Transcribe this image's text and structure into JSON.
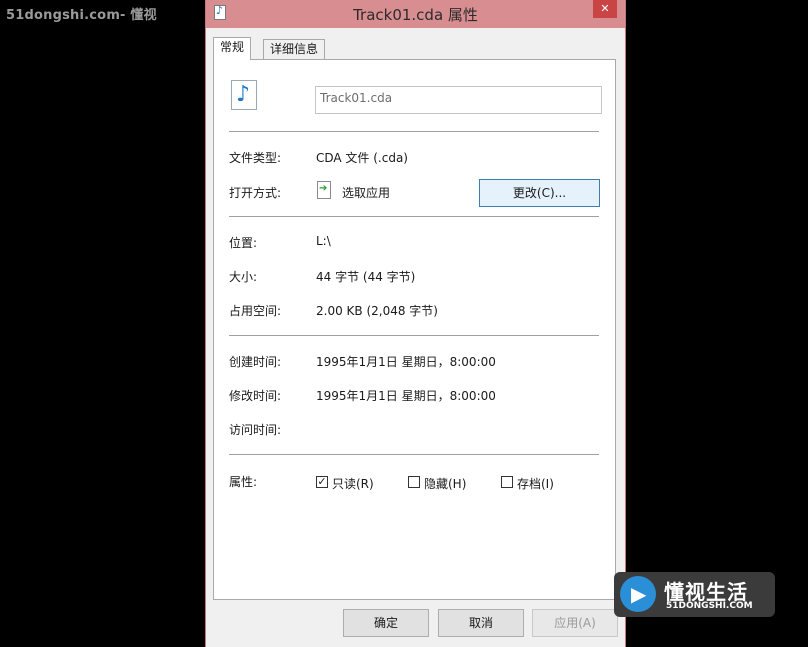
{
  "watermark": {
    "top_text": "51dongshi.com- 懂视"
  },
  "window": {
    "title": "Track01.cda 属性",
    "close_glyph": "✕"
  },
  "tabs": [
    {
      "label": "常规"
    },
    {
      "label": "详细信息"
    }
  ],
  "file": {
    "name": "Track01.cda"
  },
  "rows": {
    "type": {
      "label": "文件类型:",
      "value": "CDA 文件 (.cda)"
    },
    "open_with": {
      "label": "打开方式:",
      "value": "选取应用",
      "button": "更改(C)..."
    },
    "location": {
      "label": "位置:",
      "value": "L:\\"
    },
    "size": {
      "label": "大小:",
      "value": "44 字节 (44 字节)"
    },
    "disk_size": {
      "label": "占用空间:",
      "value": "2.00 KB (2,048 字节)"
    },
    "created": {
      "label": "创建时间:",
      "value": "1995年1月1日 星期日，8:00:00"
    },
    "modified": {
      "label": "修改时间:",
      "value": "1995年1月1日 星期日，8:00:00"
    },
    "accessed": {
      "label": "访问时间:",
      "value": ""
    }
  },
  "attributes": {
    "label": "属性:",
    "items": [
      {
        "label": "只读(R)",
        "checked": true
      },
      {
        "label": "隐藏(H)",
        "checked": false
      },
      {
        "label": "存档(I)",
        "checked": false
      }
    ]
  },
  "buttons": {
    "ok": "确定",
    "cancel": "取消",
    "apply": "应用(A)"
  },
  "logo": {
    "cn": "懂视生活",
    "en": "51DONGSHI.COM"
  },
  "icons": {
    "file_icon": "music-note-icon",
    "app_icon": "choose-app-icon"
  }
}
